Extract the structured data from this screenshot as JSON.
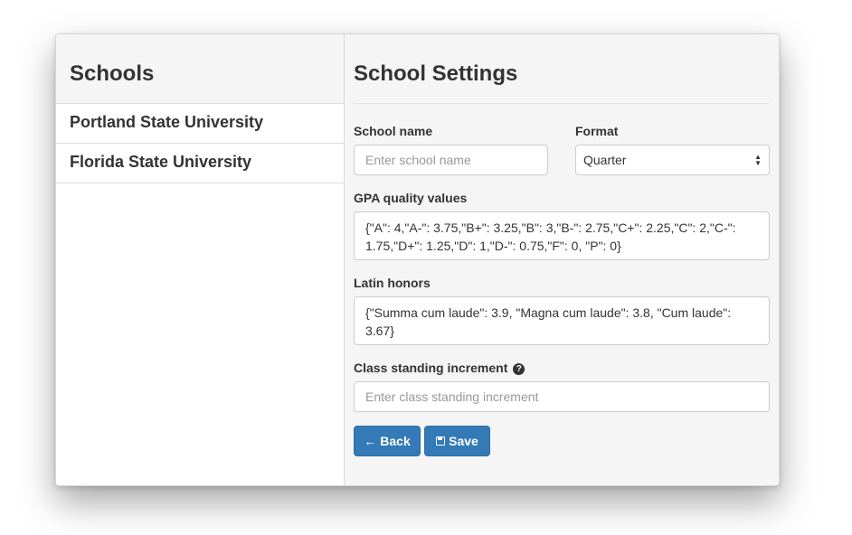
{
  "sidebar": {
    "title": "Schools",
    "schools": [
      {
        "label": "Portland State University"
      },
      {
        "label": "Florida State University"
      }
    ]
  },
  "main": {
    "title": "School Settings",
    "school_name": {
      "label": "School name",
      "value": "",
      "placeholder": "Enter school name"
    },
    "format": {
      "label": "Format",
      "selected": "Quarter"
    },
    "gpa": {
      "label": "GPA quality values",
      "value": "{\"A\": 4,\"A-\": 3.75,\"B+\": 3.25,\"B\": 3,\"B-\": 2.75,\"C+\": 2.25,\"C\": 2,\"C-\": 1.75,\"D+\": 1.25,\"D\": 1,\"D-\": 0.75,\"F\": 0, \"P\": 0}"
    },
    "latin_honors": {
      "label": "Latin honors",
      "value": "{\"Summa cum laude\": 3.9, \"Magna cum laude\": 3.8, \"Cum laude\": 3.67}"
    },
    "class_standing": {
      "label": "Class standing increment",
      "value": "",
      "placeholder": "Enter class standing increment",
      "help_icon": "question-circle-icon"
    },
    "buttons": {
      "back_label": "Back",
      "back_icon": "arrow-left-icon",
      "save_label": "Save",
      "save_icon": "floppy-disk-icon"
    }
  },
  "colors": {
    "primary": "#337ab7",
    "panel_bg": "#f5f5f5",
    "text": "#333333"
  }
}
